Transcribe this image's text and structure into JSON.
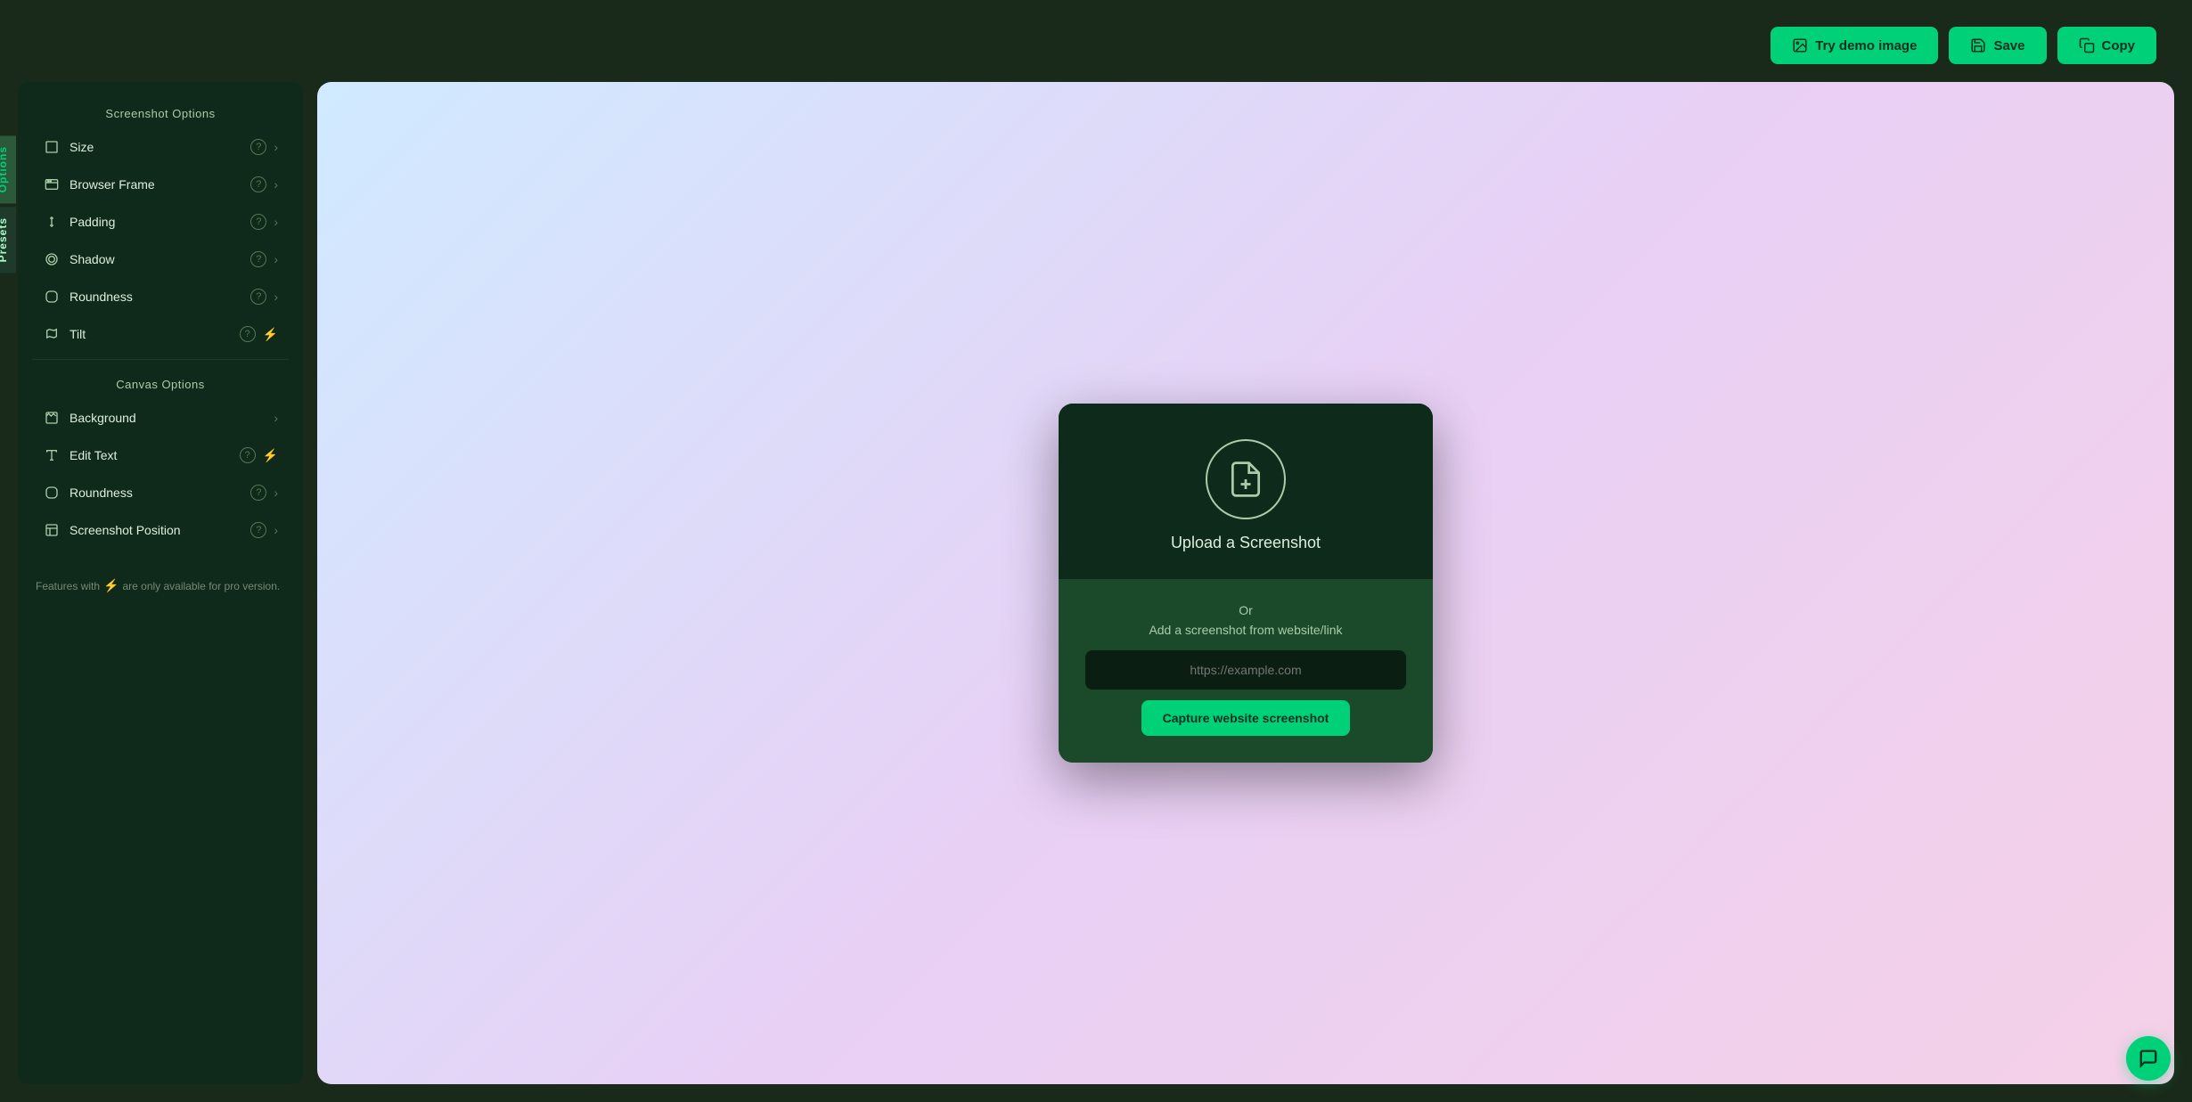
{
  "header": {
    "try_demo_label": "Try demo image",
    "save_label": "Save",
    "copy_label": "Copy"
  },
  "sidebar_tabs": [
    {
      "id": "options",
      "label": "Options",
      "active": true
    },
    {
      "id": "presets",
      "label": "Presets",
      "active": false
    }
  ],
  "screenshot_options": {
    "section_title": "Screenshot Options",
    "items": [
      {
        "id": "size",
        "label": "Size",
        "has_help": true,
        "has_chevron": true,
        "has_lightning": false
      },
      {
        "id": "browser-frame",
        "label": "Browser Frame",
        "has_help": true,
        "has_chevron": true,
        "has_lightning": false
      },
      {
        "id": "padding",
        "label": "Padding",
        "has_help": true,
        "has_chevron": true,
        "has_lightning": false
      },
      {
        "id": "shadow",
        "label": "Shadow",
        "has_help": true,
        "has_chevron": true,
        "has_lightning": false
      },
      {
        "id": "roundness",
        "label": "Roundness",
        "has_help": true,
        "has_chevron": true,
        "has_lightning": false
      },
      {
        "id": "tilt",
        "label": "Tilt",
        "has_help": true,
        "has_chevron": false,
        "has_lightning": true
      }
    ]
  },
  "canvas_options": {
    "section_title": "Canvas Options",
    "items": [
      {
        "id": "background",
        "label": "Background",
        "has_help": false,
        "has_chevron": true,
        "has_lightning": false
      },
      {
        "id": "edit-text",
        "label": "Edit Text",
        "has_help": true,
        "has_chevron": false,
        "has_lightning": true
      },
      {
        "id": "roundness",
        "label": "Roundness",
        "has_help": true,
        "has_chevron": true,
        "has_lightning": false
      },
      {
        "id": "screenshot-position",
        "label": "Screenshot Position",
        "has_help": true,
        "has_chevron": true,
        "has_lightning": false
      }
    ]
  },
  "footer_note": "Features with",
  "footer_note2": "are only available for pro version.",
  "upload_card": {
    "title": "Upload a Screenshot",
    "or_text": "Or",
    "add_text": "Add a screenshot from website/link",
    "url_placeholder": "https://example.com",
    "capture_btn_label": "Capture website screenshot"
  },
  "icons": {
    "size": "⊞",
    "browser_frame": "🖥",
    "padding": "↕",
    "shadow": "◎",
    "roundness": "⬜",
    "tilt": "◱",
    "background": "🖼",
    "edit_text": "T",
    "screenshot_position": "⊟"
  },
  "colors": {
    "accent": "#00d078",
    "bg_dark": "#1a2a1a",
    "panel_bg": "#0f2a1a",
    "lightning": "#f5c518"
  }
}
